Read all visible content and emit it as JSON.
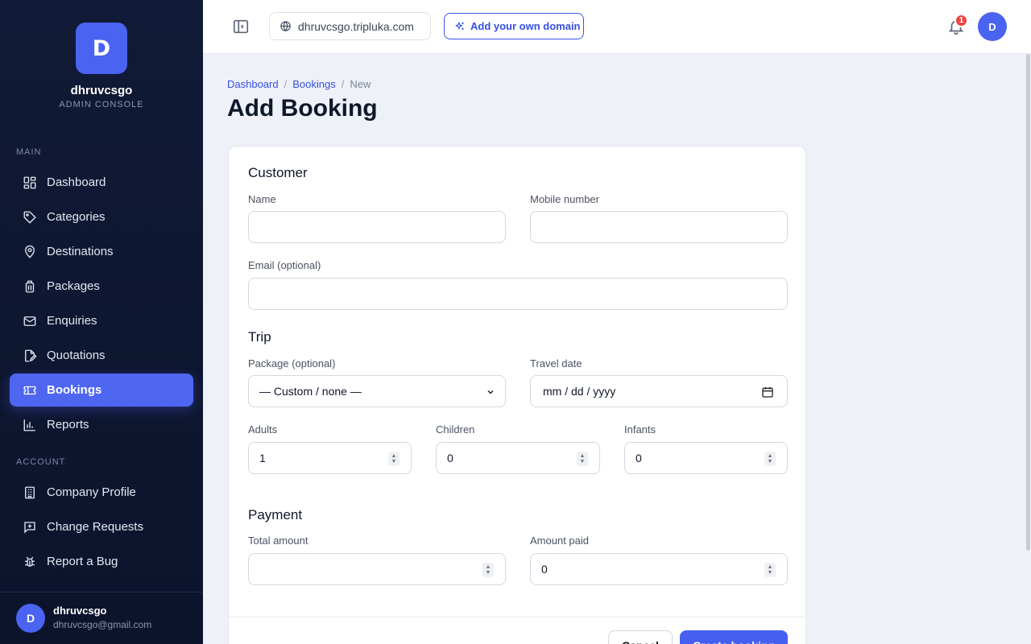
{
  "brand": {
    "logo_letter": "D",
    "name": "dhruvcsgo",
    "subtitle": "ADMIN CONSOLE"
  },
  "sidebar": {
    "main_label": "MAIN",
    "main_items": [
      {
        "label": "Dashboard",
        "icon": "dashboard-icon"
      },
      {
        "label": "Categories",
        "icon": "tag-icon"
      },
      {
        "label": "Destinations",
        "icon": "map-pin-icon"
      },
      {
        "label": "Packages",
        "icon": "luggage-icon"
      },
      {
        "label": "Enquiries",
        "icon": "mail-icon"
      },
      {
        "label": "Quotations",
        "icon": "file-edit-icon"
      },
      {
        "label": "Bookings",
        "icon": "ticket-icon",
        "active": true
      },
      {
        "label": "Reports",
        "icon": "bar-chart-icon"
      }
    ],
    "account_label": "ACCOUNT",
    "account_items": [
      {
        "label": "Company Profile",
        "icon": "building-icon"
      },
      {
        "label": "Change Requests",
        "icon": "message-plus-icon"
      },
      {
        "label": "Report a Bug",
        "icon": "bug-icon"
      }
    ],
    "user": {
      "avatar": "D",
      "name": "dhruvcsgo",
      "email": "dhruvcsgo@gmail.com"
    }
  },
  "topbar": {
    "domain": "dhruvcsgo.tripluka.com",
    "add_domain_label": "Add your own domain",
    "notification_count": "1",
    "avatar": "D"
  },
  "breadcrumb": {
    "items": [
      "Dashboard",
      "Bookings"
    ],
    "current": "New",
    "sep": "/"
  },
  "page_title": "Add Booking",
  "form": {
    "customer_heading": "Customer",
    "name_label": "Name",
    "name_value": "",
    "mobile_label": "Mobile number",
    "mobile_value": "",
    "email_label": "Email (optional)",
    "email_value": "",
    "trip_heading": "Trip",
    "package_label": "Package (optional)",
    "package_value": "— Custom / none —",
    "travel_date_label": "Travel date",
    "travel_date_placeholder": "mm / dd / yyyy",
    "adults_label": "Adults",
    "adults_value": "1",
    "children_label": "Children",
    "children_value": "0",
    "infants_label": "Infants",
    "infants_value": "0",
    "payment_heading": "Payment",
    "total_label": "Total amount",
    "total_value": "",
    "paid_label": "Amount paid",
    "paid_value": "0",
    "cancel_label": "Cancel",
    "create_label": "Create booking"
  },
  "colors": {
    "accent": "#4f66f1",
    "sidebar_bg": "#0f1732",
    "badge": "#ef4444"
  }
}
